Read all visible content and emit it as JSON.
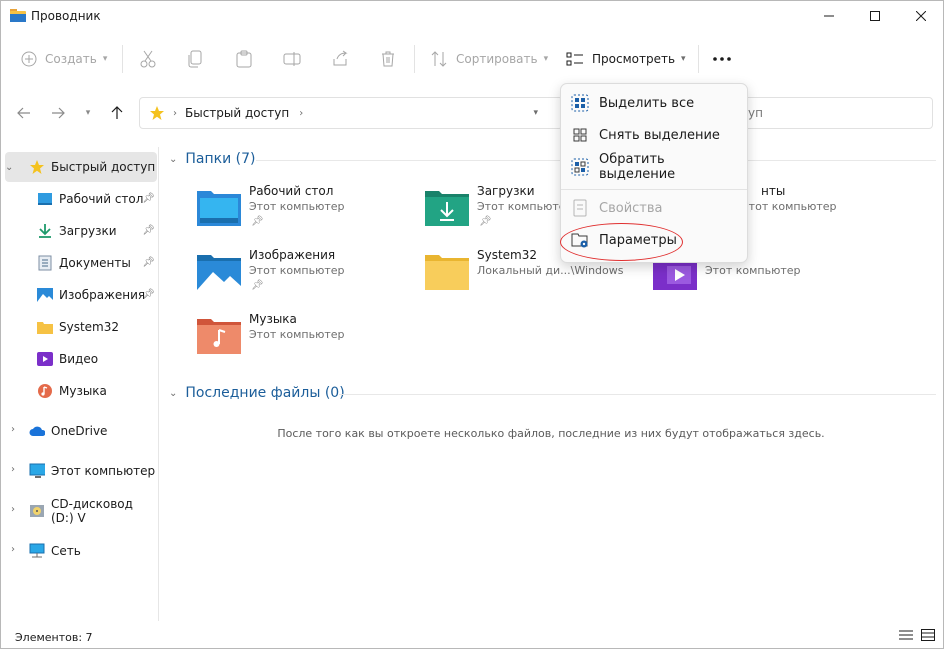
{
  "window": {
    "title": "Проводник",
    "colors": {
      "accent": "#1c5e9a",
      "highlight_circle": "#e03030"
    }
  },
  "toolbar": {
    "create_label": "Создать",
    "sort_label": "Сортировать",
    "view_label": "Просмотреть",
    "icons": [
      "cut-icon",
      "copy-icon",
      "paste-icon",
      "rename-icon",
      "share-icon",
      "delete-icon"
    ]
  },
  "address": {
    "path_label": "Быстрый доступ",
    "search_placeholder": "уп"
  },
  "sidebar": {
    "items": [
      {
        "label": "Быстрый доступ",
        "icon": "star-icon"
      },
      {
        "label": "Рабочий стол",
        "icon": "desktop-icon"
      },
      {
        "label": "Загрузки",
        "icon": "download-icon"
      },
      {
        "label": "Документы",
        "icon": "document-icon"
      },
      {
        "label": "Изображения",
        "icon": "image-icon"
      },
      {
        "label": "System32",
        "icon": "folder-icon"
      },
      {
        "label": "Видео",
        "icon": "video-icon"
      },
      {
        "label": "Музыка",
        "icon": "music-icon"
      },
      {
        "label": "OneDrive",
        "icon": "cloud-icon"
      },
      {
        "label": "Этот компьютер",
        "icon": "computer-icon"
      },
      {
        "label": "CD-дисковод (D:) V",
        "icon": "cd-drive-icon"
      },
      {
        "label": "Сеть",
        "icon": "network-icon"
      }
    ]
  },
  "main": {
    "folders_header": "Папки (7)",
    "recent_header": "Последние файлы (0)",
    "recent_empty": "После того как вы откроете несколько файлов, последние из них будут отображаться здесь.",
    "folders": [
      {
        "name": "Рабочий стол",
        "sub": "Этот компьютер"
      },
      {
        "name": "Загрузки",
        "sub": "Этот компьютер"
      },
      {
        "name": "нты",
        "sub": "Этот компьютер"
      },
      {
        "name": "Изображения",
        "sub": "Этот компьютер"
      },
      {
        "name": "System32",
        "sub": "Локальный ди...\\Windows"
      },
      {
        "name": "",
        "sub": "Этот компьютер"
      },
      {
        "name": "Музыка",
        "sub": "Этот компьютер"
      }
    ]
  },
  "menu": {
    "items": [
      {
        "label": "Выделить все",
        "icon": "select-all-icon"
      },
      {
        "label": "Снять выделение",
        "icon": "select-none-icon"
      },
      {
        "label": "Обратить выделение",
        "icon": "invert-selection-icon"
      },
      {
        "label": "Свойства",
        "icon": "properties-icon"
      },
      {
        "label": "Параметры",
        "icon": "folder-options-icon"
      }
    ]
  },
  "status": {
    "items_text": "Элементов: 7"
  }
}
